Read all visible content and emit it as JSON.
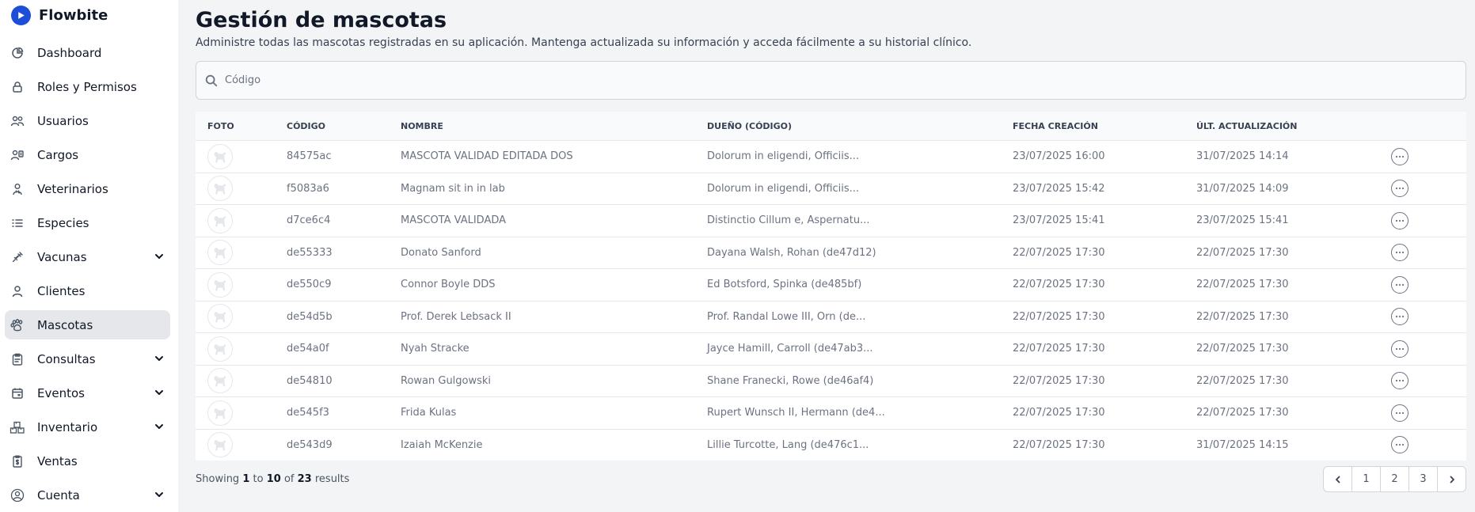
{
  "brand": {
    "name": "Flowbite"
  },
  "sidebar": {
    "items": [
      {
        "label": "Dashboard",
        "icon": "chart-pie-icon",
        "has_chevron": false,
        "active": false
      },
      {
        "label": "Roles y Permisos",
        "icon": "lock-icon",
        "has_chevron": false,
        "active": false
      },
      {
        "label": "Usuarios",
        "icon": "users-icon",
        "has_chevron": false,
        "active": false
      },
      {
        "label": "Cargos",
        "icon": "user-tag-icon",
        "has_chevron": false,
        "active": false
      },
      {
        "label": "Veterinarios",
        "icon": "doctor-icon",
        "has_chevron": false,
        "active": false
      },
      {
        "label": "Especies",
        "icon": "list-icon",
        "has_chevron": false,
        "active": false
      },
      {
        "label": "Vacunas",
        "icon": "syringe-icon",
        "has_chevron": true,
        "active": false
      },
      {
        "label": "Clientes",
        "icon": "user-icon",
        "has_chevron": false,
        "active": false
      },
      {
        "label": "Mascotas",
        "icon": "paw-icon",
        "has_chevron": false,
        "active": true
      },
      {
        "label": "Consultas",
        "icon": "clipboard-icon",
        "has_chevron": true,
        "active": false
      },
      {
        "label": "Eventos",
        "icon": "calendar-icon",
        "has_chevron": true,
        "active": false
      },
      {
        "label": "Inventario",
        "icon": "boxes-icon",
        "has_chevron": true,
        "active": false
      },
      {
        "label": "Ventas",
        "icon": "receipt-icon",
        "has_chevron": false,
        "active": false
      },
      {
        "label": "Cuenta",
        "icon": "user-circle-icon",
        "has_chevron": true,
        "active": false
      }
    ]
  },
  "page": {
    "title": "Gestión de mascotas",
    "subtitle": "Administre todas las mascotas registradas en su aplicación. Mantenga actualizada su información y acceda fácilmente a su historial clínico."
  },
  "search": {
    "placeholder": "Código",
    "value": ""
  },
  "table": {
    "headers": {
      "foto": "FOTO",
      "codigo": "CÓDIGO",
      "nombre": "NOMBRE",
      "dueno": "DUEÑO (CÓDIGO)",
      "fecha": "FECHA CREACIÓN",
      "ult": "ÚLT. ACTUALIZACIÓN"
    },
    "rows": [
      {
        "codigo": "84575ac",
        "nombre": "MASCOTA VALIDAD EDITADA DOS",
        "dueno": "Dolorum in eligendi, Officiis...",
        "fecha": "23/07/2025 16:00",
        "ult": "31/07/2025 14:14"
      },
      {
        "codigo": "f5083a6",
        "nombre": "Magnam sit in in lab",
        "dueno": "Dolorum in eligendi, Officiis...",
        "fecha": "23/07/2025 15:42",
        "ult": "31/07/2025 14:09"
      },
      {
        "codigo": "d7ce6c4",
        "nombre": "MASCOTA VALIDADA",
        "dueno": "Distinctio Cillum e, Aspernatu...",
        "fecha": "23/07/2025 15:41",
        "ult": "23/07/2025 15:41"
      },
      {
        "codigo": "de55333",
        "nombre": "Donato Sanford",
        "dueno": "Dayana Walsh, Rohan (de47d12)",
        "fecha": "22/07/2025 17:30",
        "ult": "22/07/2025 17:30"
      },
      {
        "codigo": "de550c9",
        "nombre": "Connor Boyle DDS",
        "dueno": "Ed Botsford, Spinka (de485bf)",
        "fecha": "22/07/2025 17:30",
        "ult": "22/07/2025 17:30"
      },
      {
        "codigo": "de54d5b",
        "nombre": "Prof. Derek Lebsack II",
        "dueno": "Prof. Randal Lowe III, Orn (de...",
        "fecha": "22/07/2025 17:30",
        "ult": "22/07/2025 17:30"
      },
      {
        "codigo": "de54a0f",
        "nombre": "Nyah Stracke",
        "dueno": "Jayce Hamill, Carroll (de47ab3...",
        "fecha": "22/07/2025 17:30",
        "ult": "22/07/2025 17:30"
      },
      {
        "codigo": "de54810",
        "nombre": "Rowan Gulgowski",
        "dueno": "Shane Franecki, Rowe (de46af4)",
        "fecha": "22/07/2025 17:30",
        "ult": "22/07/2025 17:30"
      },
      {
        "codigo": "de545f3",
        "nombre": "Frida Kulas",
        "dueno": "Rupert Wunsch II, Hermann (de4...",
        "fecha": "22/07/2025 17:30",
        "ult": "22/07/2025 17:30"
      },
      {
        "codigo": "de543d9",
        "nombre": "Izaiah McKenzie",
        "dueno": "Lillie Turcotte, Lang (de476c1...",
        "fecha": "22/07/2025 17:30",
        "ult": "31/07/2025 14:15"
      }
    ]
  },
  "pagination": {
    "showing": "Showing",
    "from": "1",
    "to_word": "to",
    "to": "10",
    "of_word": "of",
    "total": "23",
    "results": "results",
    "pages": [
      "1",
      "2",
      "3"
    ]
  },
  "colors": {
    "brand": "#1d4ed8",
    "active_bg": "#e5e7eb",
    "page_bg": "#f3f4f6"
  }
}
